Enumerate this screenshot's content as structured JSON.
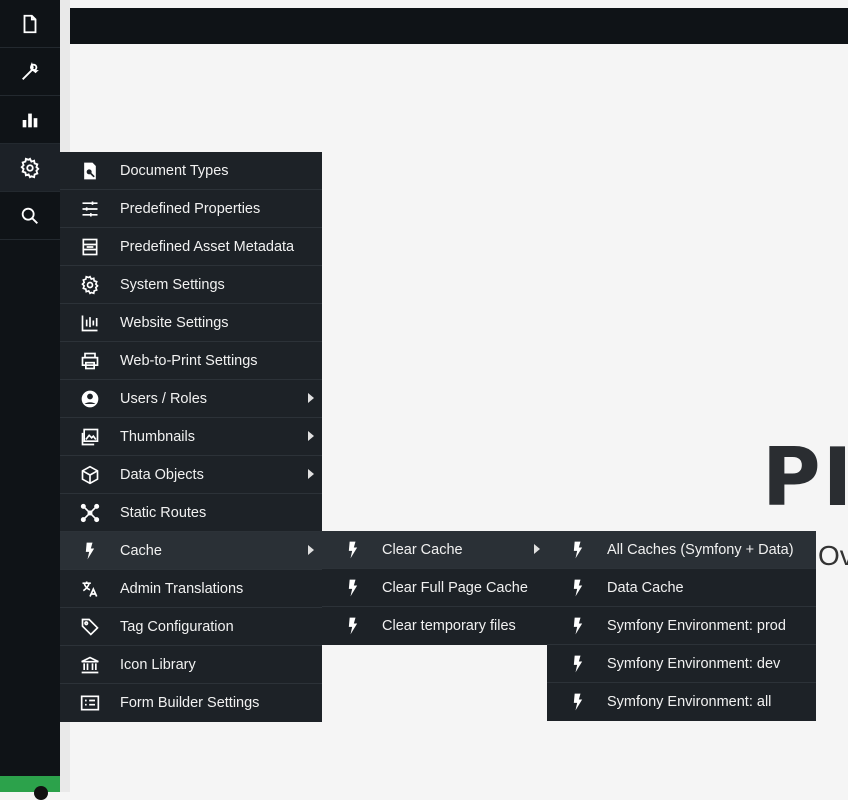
{
  "sidebar": {
    "items": [
      {
        "name": "file-icon"
      },
      {
        "name": "wrench-icon"
      },
      {
        "name": "bar-chart-icon"
      },
      {
        "name": "gear-icon",
        "active": true
      },
      {
        "name": "search-icon"
      }
    ]
  },
  "background": {
    "logo_text": "PI",
    "sub_text": "Ov"
  },
  "settings_menu": {
    "items": [
      {
        "label": "Document Types",
        "icon": "document-types-icon"
      },
      {
        "label": "Predefined Properties",
        "icon": "sliders-icon"
      },
      {
        "label": "Predefined Asset Metadata",
        "icon": "asset-metadata-icon"
      },
      {
        "label": "System Settings",
        "icon": "gear-icon"
      },
      {
        "label": "Website Settings",
        "icon": "website-settings-icon"
      },
      {
        "label": "Web-to-Print Settings",
        "icon": "printer-icon"
      },
      {
        "label": "Users / Roles",
        "icon": "user-circle-icon",
        "submenu": true
      },
      {
        "label": "Thumbnails",
        "icon": "images-icon",
        "submenu": true
      },
      {
        "label": "Data Objects",
        "icon": "cube-icon",
        "submenu": true
      },
      {
        "label": "Static Routes",
        "icon": "routes-icon"
      },
      {
        "label": "Cache",
        "icon": "bolt-icon",
        "submenu": true,
        "hover": true
      },
      {
        "label": "Admin Translations",
        "icon": "translate-icon"
      },
      {
        "label": "Tag Configuration",
        "icon": "tag-icon"
      },
      {
        "label": "Icon Library",
        "icon": "library-icon"
      },
      {
        "label": "Form Builder Settings",
        "icon": "form-icon"
      }
    ]
  },
  "cache_menu": {
    "items": [
      {
        "label": "Clear Cache",
        "icon": "bolt-icon",
        "submenu": true,
        "hover": true
      },
      {
        "label": "Clear Full Page Cache",
        "icon": "bolt-icon"
      },
      {
        "label": "Clear temporary files",
        "icon": "bolt-icon"
      }
    ]
  },
  "clear_cache_menu": {
    "items": [
      {
        "label": "All Caches (Symfony + Data)",
        "icon": "bolt-icon",
        "hover": true
      },
      {
        "label": "Data Cache",
        "icon": "bolt-icon"
      },
      {
        "label": "Symfony Environment: prod",
        "icon": "bolt-icon"
      },
      {
        "label": "Symfony Environment: dev",
        "icon": "bolt-icon"
      },
      {
        "label": "Symfony Environment: all",
        "icon": "bolt-icon"
      }
    ]
  },
  "colors": {
    "sidebar_bg": "#0f1317",
    "menu_bg": "#1d2227",
    "menu_hover": "#2a3036",
    "status_green": "#2ca24b",
    "page_bg": "#f5f5f5"
  }
}
